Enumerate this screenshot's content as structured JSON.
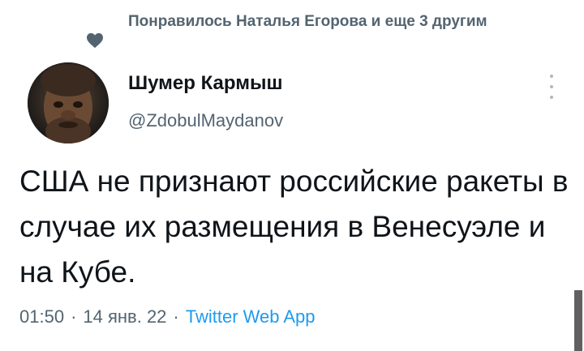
{
  "social_context": "Понравилось Наталья Егорова и еще 3 другим",
  "author": {
    "display_name": "Шумер Кармыш",
    "handle": "@ZdobulMaydanov"
  },
  "tweet": {
    "text": "США не признают российские ракеты в случае их размещения в Венесуэле и на Кубе."
  },
  "meta": {
    "time": "01:50",
    "separator": "·",
    "date": "14 янв. 22",
    "source": "Twitter Web App"
  },
  "icons": {
    "liked": "heart-icon",
    "more": "more-vertical-icon"
  },
  "colors": {
    "secondary_text": "#536471",
    "link": "#1d9bf0",
    "primary_text": "#0f1419"
  }
}
